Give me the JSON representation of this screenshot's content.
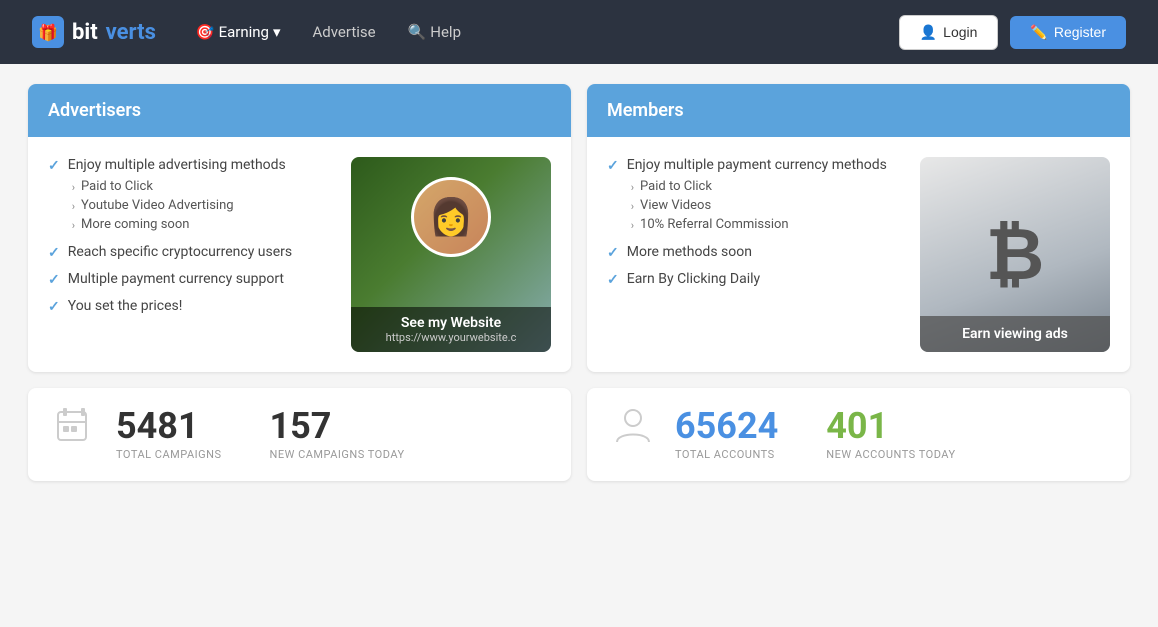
{
  "nav": {
    "logo_bit": "bit",
    "logo_verts": "verts",
    "earning_label": "Earning",
    "advertise_label": "Advertise",
    "help_label": "Help",
    "login_label": "Login",
    "register_label": "Register"
  },
  "advertisers_panel": {
    "header": "Advertisers",
    "items": [
      {
        "text": "Enjoy multiple advertising methods",
        "subitems": [
          "Paid to Click",
          "Youtube Video Advertising",
          "More coming soon"
        ]
      },
      {
        "text": "Reach specific cryptocurrency users",
        "subitems": []
      },
      {
        "text": "Multiple payment currency support",
        "subitems": []
      },
      {
        "text": "You set the prices!",
        "subitems": []
      }
    ],
    "ad_card": {
      "site_name": "See my Website",
      "site_url": "https://www.yourwebsite.c"
    }
  },
  "members_panel": {
    "header": "Members",
    "items": [
      {
        "text": "Enjoy multiple payment currency methods",
        "subitems": [
          "Paid to Click",
          "View Videos",
          "10% Referral Commission"
        ]
      },
      {
        "text": "More methods soon",
        "subitems": []
      },
      {
        "text": "Earn By Clicking Daily",
        "subitems": []
      }
    ],
    "bitcoin_card": {
      "symbol": "₿",
      "label": "Earn viewing ads"
    }
  },
  "stats_left": {
    "icon": "🗂",
    "total_value": "5481",
    "total_label": "TOTAL CAMPAIGNS",
    "new_value": "157",
    "new_label": "NEW CAMPAIGNS TODAY"
  },
  "stats_right": {
    "icon": "👥",
    "total_value": "65624",
    "total_label": "TOTAL ACCOUNTS",
    "new_value": "401",
    "new_label": "NEW ACCOUNTS TODAY"
  }
}
